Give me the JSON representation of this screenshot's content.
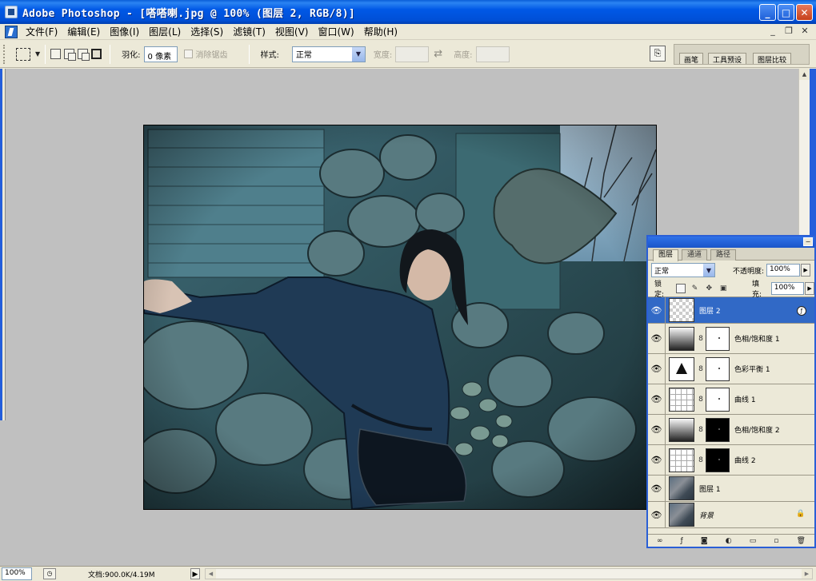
{
  "window": {
    "title": "Adobe Photoshop - [嗒嗒喇.jpg @ 100% (图层 2, RGB/8)]",
    "controls": {
      "minimize": "_",
      "maximize": "□",
      "close": "✕"
    }
  },
  "menu": {
    "items": [
      "文件(F)",
      "编辑(E)",
      "图像(I)",
      "图层(L)",
      "选择(S)",
      "滤镜(T)",
      "视图(V)",
      "窗口(W)",
      "帮助(H)"
    ],
    "doc_controls": {
      "minimize": "_",
      "restore": "❐",
      "close": "✕"
    }
  },
  "options": {
    "feather_label": "羽化:",
    "feather_value": "0 像素",
    "antialias_label": "消除锯齿",
    "style_label": "样式:",
    "style_value": "正常",
    "width_label": "宽度:",
    "height_label": "高度:",
    "well_tabs": [
      "画笔",
      "工具预设",
      "图层比较"
    ]
  },
  "layers_panel": {
    "tabs": [
      "图层",
      "通道",
      "路径"
    ],
    "blend_mode": "正常",
    "opacity_label": "不透明度:",
    "opacity_value": "100%",
    "lock_label": "锁定:",
    "fill_label": "填充:",
    "fill_value": "100%",
    "layers": [
      {
        "name": "图层 2",
        "selected": true
      },
      {
        "name": "色相/饱和度 1"
      },
      {
        "name": "色彩平衡 1"
      },
      {
        "name": "曲线 1"
      },
      {
        "name": "色相/饱和度 2"
      },
      {
        "name": "曲线 2"
      },
      {
        "name": "图层 1"
      },
      {
        "name": "背景"
      }
    ]
  },
  "status": {
    "zoom": "100%",
    "doc_info": "文档:900.0K/4.19M"
  },
  "colors": {
    "titlebar": "#0058e6",
    "panel_bg": "#ece9d8",
    "workspace": "#c0c0c0",
    "selection": "#3169c6"
  }
}
